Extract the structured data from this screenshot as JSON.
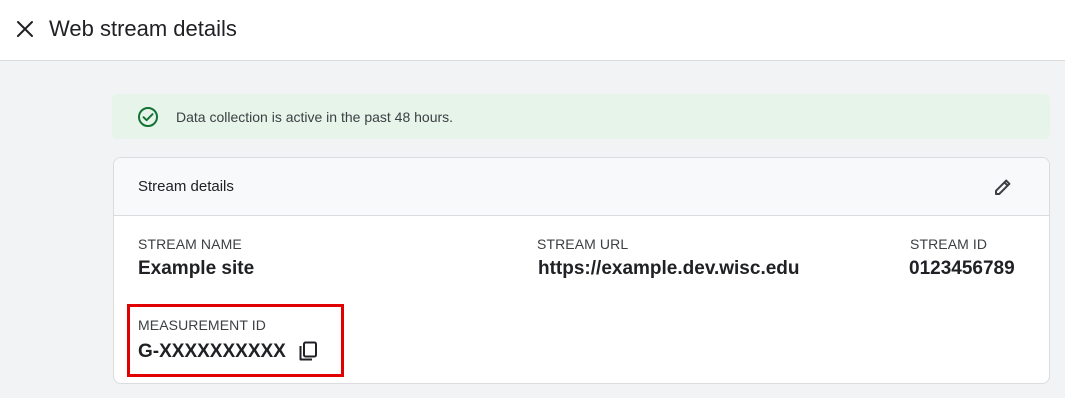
{
  "header": {
    "title": "Web stream details",
    "close_icon": "close-icon"
  },
  "banner": {
    "text": "Data collection is active in the past 48 hours.",
    "icon": "check-circle-icon",
    "background": "#e6f4ea",
    "icon_color": "#137333"
  },
  "card": {
    "title": "Stream details",
    "edit_icon": "pencil-icon",
    "fields": {
      "stream_name": {
        "label": "STREAM NAME",
        "value": "Example site"
      },
      "stream_url": {
        "label": "STREAM URL",
        "value": "https://example.dev.wisc.edu"
      },
      "stream_id": {
        "label": "STREAM ID",
        "value": "0123456789"
      },
      "measurement_id": {
        "label": "MEASUREMENT ID",
        "value": "G-XXXXXXXXXX",
        "copy_icon": "copy-icon"
      }
    }
  },
  "annotation": {
    "highlight_color": "#e00000"
  }
}
